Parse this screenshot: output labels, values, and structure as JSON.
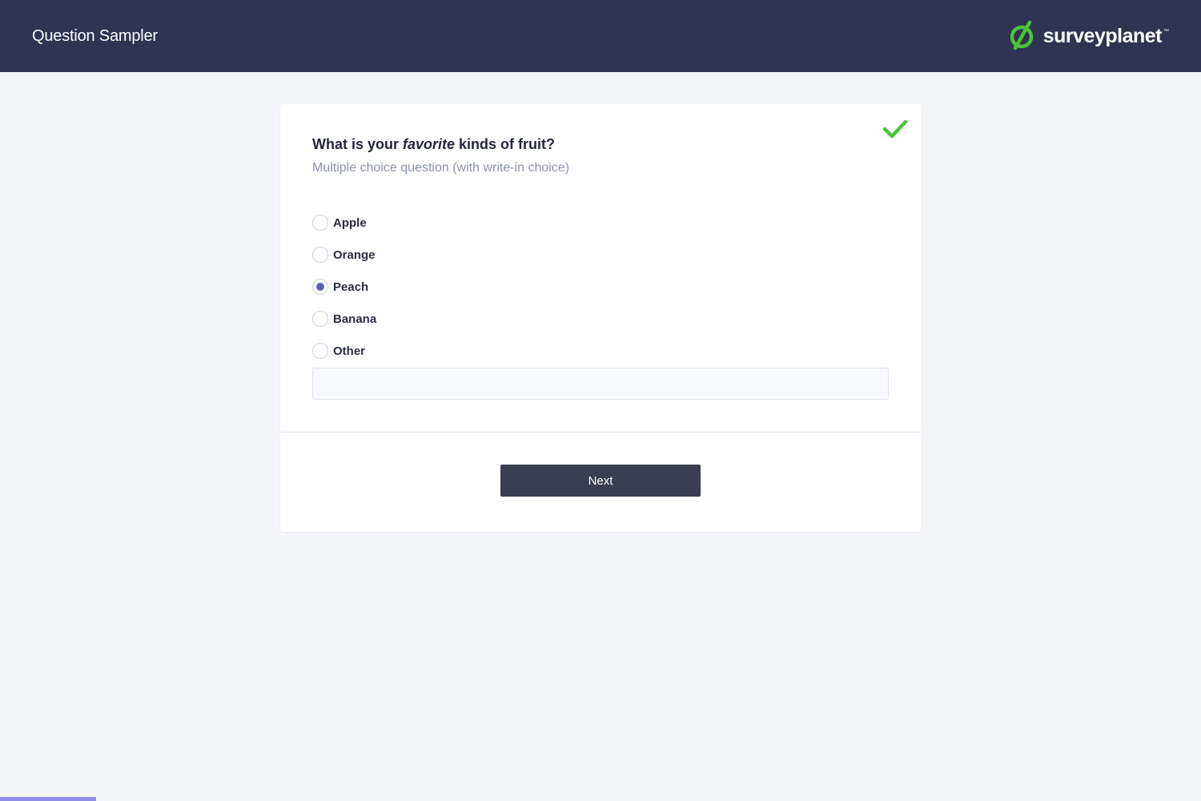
{
  "header": {
    "title": "Question Sampler",
    "brand_name": "surveyplanet",
    "brand_tm": "™"
  },
  "question": {
    "prefix": "What is your ",
    "emphasis": "favorite",
    "suffix": " kinds of fruit?",
    "subtitle": "Multiple choice question (with write-in choice)",
    "answered_icon": "check-icon",
    "options": [
      {
        "label": "Apple",
        "selected": false
      },
      {
        "label": "Orange",
        "selected": false
      },
      {
        "label": "Peach",
        "selected": true
      },
      {
        "label": "Banana",
        "selected": false
      },
      {
        "label": "Other",
        "selected": false
      }
    ],
    "write_in_value": "",
    "write_in_placeholder": ""
  },
  "footer": {
    "next_label": "Next"
  },
  "progress": {
    "fraction": 0.08
  },
  "colors": {
    "header_bg": "#303452",
    "accent": "#5b5fb5",
    "brand_green": "#4bc43a",
    "check_green": "#4bc43a",
    "button_bg": "#3a3e50",
    "progress": "#8f8fe6"
  }
}
